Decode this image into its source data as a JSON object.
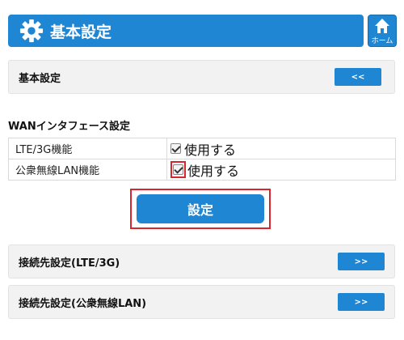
{
  "header": {
    "title": "基本設定",
    "home_label": "ホーム"
  },
  "basic_bar": {
    "label": "基本設定",
    "button": "<<"
  },
  "wan": {
    "heading": "WANインタフェース設定",
    "rows": [
      {
        "name": "LTE/3G機能",
        "checked": true,
        "option_label": "使用する"
      },
      {
        "name": "公衆無線LAN機能",
        "checked": true,
        "option_label": "使用する"
      }
    ]
  },
  "submit_label": "設定",
  "sections": [
    {
      "label": "接続先設定(LTE/3G)",
      "button": ">>"
    },
    {
      "label": "接続先設定(公衆無線LAN)",
      "button": ">>"
    }
  ],
  "colors": {
    "accent": "#1f86d3",
    "highlight": "#d7262e",
    "bar_bg": "#f2f2f2"
  },
  "icons": [
    "gear-icon",
    "home-icon",
    "checkbox-icon"
  ]
}
